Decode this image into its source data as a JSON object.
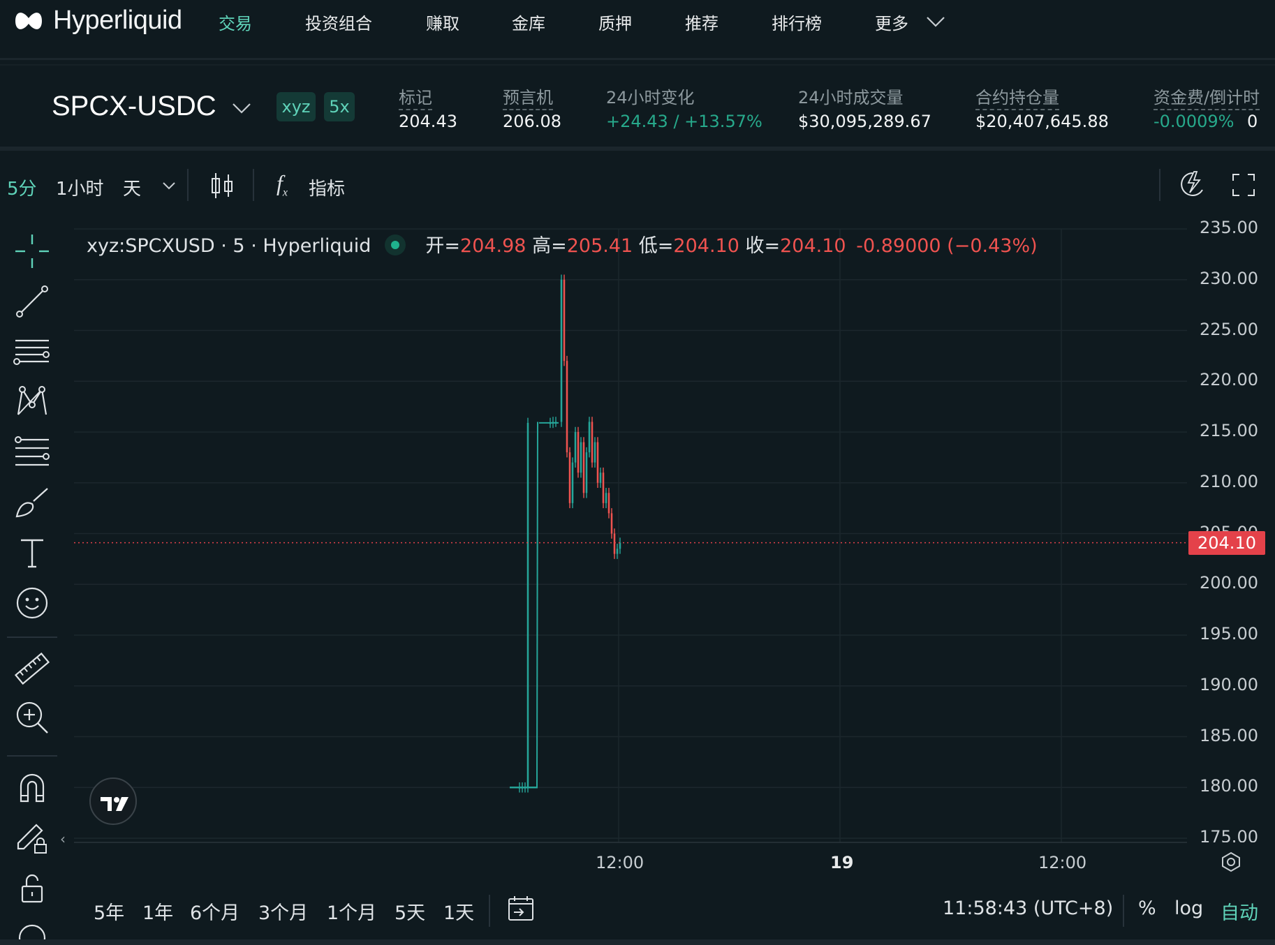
{
  "nav": {
    "brand": "Hyperliquid",
    "items": [
      "交易",
      "投资组合",
      "赚取",
      "金库",
      "质押",
      "推荐",
      "排行榜",
      "更多"
    ]
  },
  "ticker": {
    "pair": "SPCX-USDC",
    "tags": [
      "xyz",
      "5x"
    ],
    "stats": [
      {
        "label": "标记",
        "value": "204.43"
      },
      {
        "label": "预言机",
        "value": "206.08"
      },
      {
        "label": "24小时变化",
        "value": "+24.43 / +13.57%"
      },
      {
        "label": "24小时成交量",
        "value": "$30,095,289.67"
      },
      {
        "label": "合约持仓量",
        "value": "$20,407,645.88"
      },
      {
        "label": "资金费/倒计时",
        "value": "-0.0009%"
      }
    ]
  },
  "toolbar": {
    "timeframes": [
      "5分",
      "1小时",
      "天"
    ],
    "indicators_label": "指标"
  },
  "legend": {
    "symbol": "xyz:SPCXUSD · 5 · Hyperliquid",
    "open_label": "开=",
    "open": "204.98",
    "high_label": "高=",
    "high": "205.41",
    "low_label": "低=",
    "low": "204.10",
    "close_label": "收=",
    "close": "204.10",
    "change": "-0.89000 (−0.43%)"
  },
  "chart_data": {
    "type": "candlestick",
    "symbol": "xyz:SPCXUSD",
    "interval": "5",
    "y_ticks": [
      "235.00",
      "230.00",
      "225.00",
      "220.00",
      "215.00",
      "210.00",
      "205.00",
      "200.00",
      "195.00",
      "190.00",
      "185.00",
      "180.00",
      "175.00"
    ],
    "ylim": [
      175,
      235
    ],
    "x_ticks": [
      "12:00",
      "19",
      "12:00"
    ],
    "last_price": "204.10",
    "price_path": [
      180,
      180,
      180,
      180,
      215.9,
      215.9,
      216,
      216,
      230,
      222,
      213,
      208,
      212,
      215,
      211,
      214,
      209,
      213,
      216,
      212,
      214,
      210,
      211,
      208,
      209,
      207,
      205,
      203,
      203.5,
      204.1
    ],
    "colors": {
      "up": "#26a69a",
      "down": "#ef5350"
    }
  },
  "bottombar": {
    "ranges": [
      "5年",
      "1年",
      "6个月",
      "3个月",
      "1个月",
      "5天",
      "1天"
    ],
    "clock": "11:58:43 (UTC+8)",
    "percent": "%",
    "log": "log",
    "auto": "自动"
  },
  "colors": {
    "accent": "#5fd3b9",
    "background": "#0f1a1f",
    "up": "#26a69a",
    "down": "#ef5350",
    "price_tag": "#e4424a"
  }
}
